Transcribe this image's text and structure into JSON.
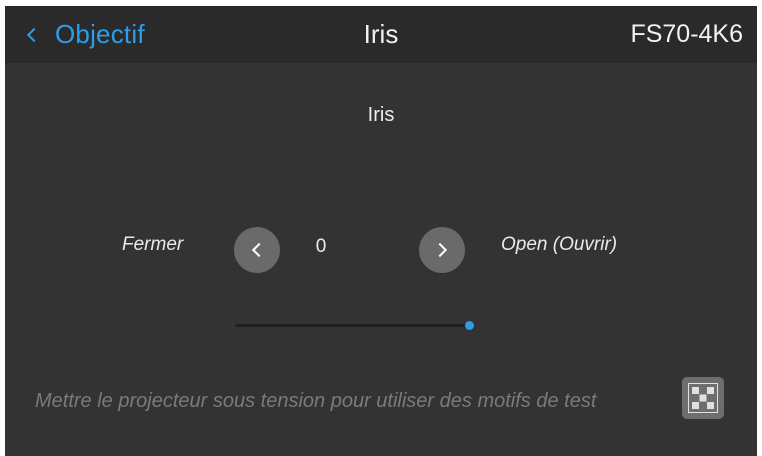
{
  "header": {
    "back_label": "Objectif",
    "title": "Iris",
    "model": "FS70-4K6"
  },
  "iris": {
    "section_label": "Iris",
    "close_label": "Fermer",
    "open_label": "Open (Ouvrir)",
    "value": "0",
    "slider_position": 1.0
  },
  "footer": {
    "hint": "Mettre le projecteur sous tension pour utiliser des motifs de test"
  },
  "icons": {
    "back": "chevron-left-icon",
    "decrease": "chevron-left-icon",
    "increase": "chevron-right-icon",
    "test_pattern": "checkerboard-icon"
  },
  "colors": {
    "accent": "#2a9ee6",
    "background": "#333333",
    "header": "#2a2a2a",
    "button": "#6a6a6a",
    "disabled_text": "#7a7a7a"
  }
}
